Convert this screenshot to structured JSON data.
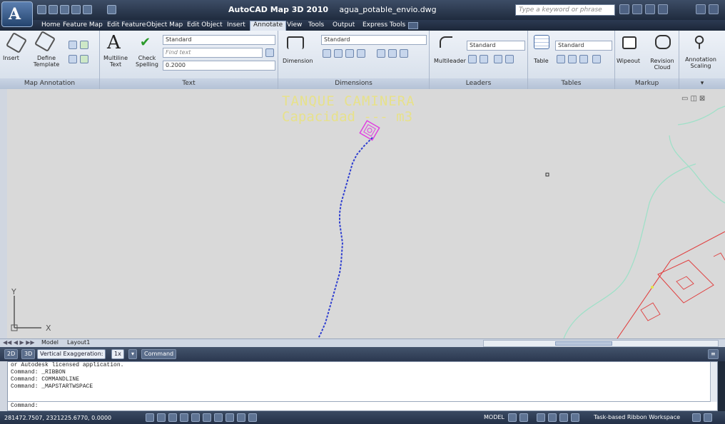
{
  "titlebar": {
    "app_name": "AutoCAD Map 3D 2010",
    "file_name": "agua_potable_envio.dwg",
    "search_placeholder": "Type a keyword or phrase"
  },
  "tabs": [
    {
      "label": "Home"
    },
    {
      "label": "Feature Map"
    },
    {
      "label": "Edit Feature"
    },
    {
      "label": "Object Map"
    },
    {
      "label": "Edit Object"
    },
    {
      "label": "Insert"
    },
    {
      "label": "Annotate"
    },
    {
      "label": "View"
    },
    {
      "label": "Tools"
    },
    {
      "label": "Output"
    },
    {
      "label": "Express Tools"
    }
  ],
  "active_tab": "Annotate",
  "ribbon": {
    "map_annotation": {
      "title": "Map Annotation",
      "insert": "Insert",
      "define_template": "Define\nTemplate"
    },
    "text": {
      "title": "Text",
      "multiline_text": "Multiline\nText",
      "check_spelling": "Check\nSpelling",
      "style": "Standard",
      "find_placeholder": "Find text",
      "height": "0.2000"
    },
    "dimensions": {
      "title": "Dimensions",
      "dimension": "Dimension",
      "style": "Standard"
    },
    "leaders": {
      "title": "Leaders",
      "multileader": "Multileader",
      "style": "Standard"
    },
    "tables": {
      "title": "Tables",
      "table": "Table",
      "style": "Standard"
    },
    "markup": {
      "title": "Markup",
      "wipeout": "Wipeout",
      "revision_cloud": "Revision\nCloud"
    },
    "scaling": {
      "annotation_scaling": "Annotation\nScaling"
    }
  },
  "drawing": {
    "label_line1": "TANQUE CAMINERA",
    "label_line2": "Capacidad --- m3",
    "ucs_y": "Y",
    "ucs_x": "X"
  },
  "layout_tabs": [
    "Model",
    "Layout1"
  ],
  "map_toolbar": {
    "btn_2d": "2D",
    "btn_3d": "3D",
    "vertical_exaggeration_label": "Vertical Exaggeration:",
    "vertical_exaggeration_value": "1x",
    "command_label": "Command"
  },
  "command_line": {
    "history": [
      "or Autodesk licensed application.",
      "Command:  _RIBBON",
      "Command:  COMMANDLINE",
      "Command:  _MAPSTARTWSPACE"
    ],
    "prompt": "Command:"
  },
  "status_bar": {
    "coordinates": "281472.7507, 2321225.6770, 0.0000",
    "model": "MODEL",
    "workspace": "Task-based Ribbon Workspace"
  },
  "colors": {
    "canvas_bg": "#d9d9d9",
    "pipe_blue": "#2f3fd0",
    "label_yellow": "#e7e18b",
    "tank_magenta": "#e040e0",
    "contour_teal": "#9fe0c8",
    "parcel_red": "#e04040"
  }
}
